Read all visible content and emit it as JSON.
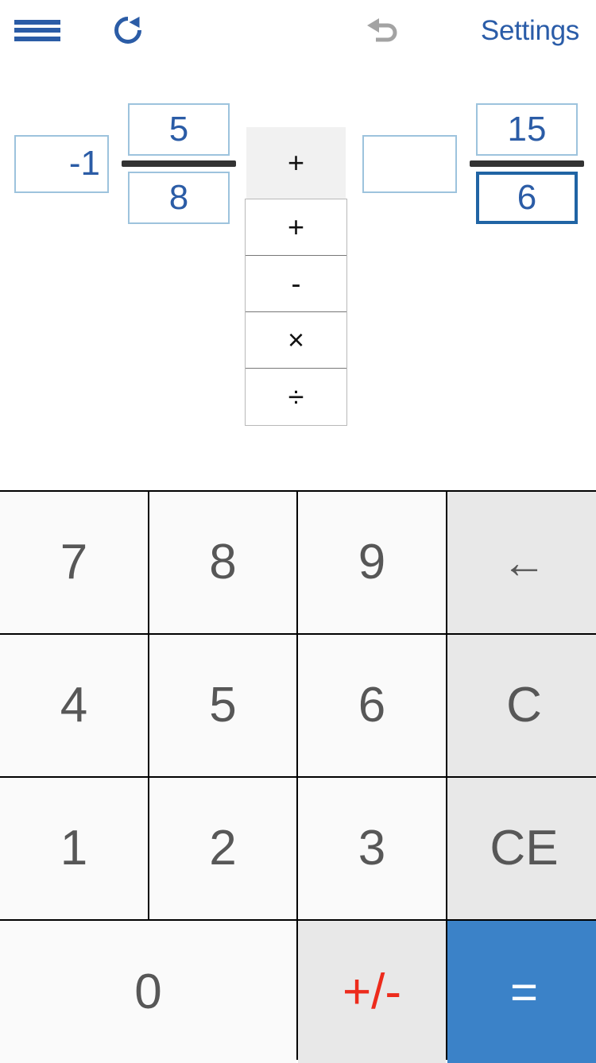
{
  "header": {
    "menu_icon": "hamburger-menu-icon",
    "redo_icon": "refresh-reset-icon",
    "undo_icon": "undo-arrow-icon",
    "settings_label": "Settings",
    "accent_color": "#2a5ca8",
    "disabled_color": "#a3a3a3"
  },
  "expression": {
    "left_operand": {
      "whole": "-1",
      "numerator": "5",
      "denominator": "8",
      "focused_field": ""
    },
    "operator": {
      "selected": "+",
      "options": [
        "+",
        "-",
        "×",
        "÷"
      ],
      "expanded": true
    },
    "right_operand": {
      "whole": "",
      "numerator": "15",
      "denominator": "6",
      "focused_field": "denominator"
    },
    "field_border_color": "#9dc3dd",
    "focused_border_color": "#2064a4",
    "digit_color": "#2b5ca6",
    "fraction_bar_color": "#333333"
  },
  "keypad": {
    "rows": [
      [
        {
          "label": "7",
          "name": "key-7",
          "style": "digit"
        },
        {
          "label": "8",
          "name": "key-8",
          "style": "digit"
        },
        {
          "label": "9",
          "name": "key-9",
          "style": "digit"
        },
        {
          "label": "←",
          "name": "key-backspace",
          "style": "gray"
        }
      ],
      [
        {
          "label": "4",
          "name": "key-4",
          "style": "digit"
        },
        {
          "label": "5",
          "name": "key-5",
          "style": "digit"
        },
        {
          "label": "6",
          "name": "key-6",
          "style": "digit"
        },
        {
          "label": "C",
          "name": "key-clear",
          "style": "gray"
        }
      ],
      [
        {
          "label": "1",
          "name": "key-1",
          "style": "digit"
        },
        {
          "label": "2",
          "name": "key-2",
          "style": "digit"
        },
        {
          "label": "3",
          "name": "key-3",
          "style": "digit"
        },
        {
          "label": "CE",
          "name": "key-clear-entry",
          "style": "gray"
        }
      ],
      [
        {
          "label": "0",
          "name": "key-0",
          "style": "wide"
        },
        {
          "label": "+/-",
          "name": "key-sign-toggle",
          "style": "danger"
        },
        {
          "label": "=",
          "name": "key-equals",
          "style": "accent"
        }
      ]
    ],
    "digit_color": "#575757",
    "gray_bg": "#e8e8e8",
    "key_bg": "#fafafa",
    "accent_bg": "#3b82c8",
    "danger_color": "#ed2b1c"
  }
}
